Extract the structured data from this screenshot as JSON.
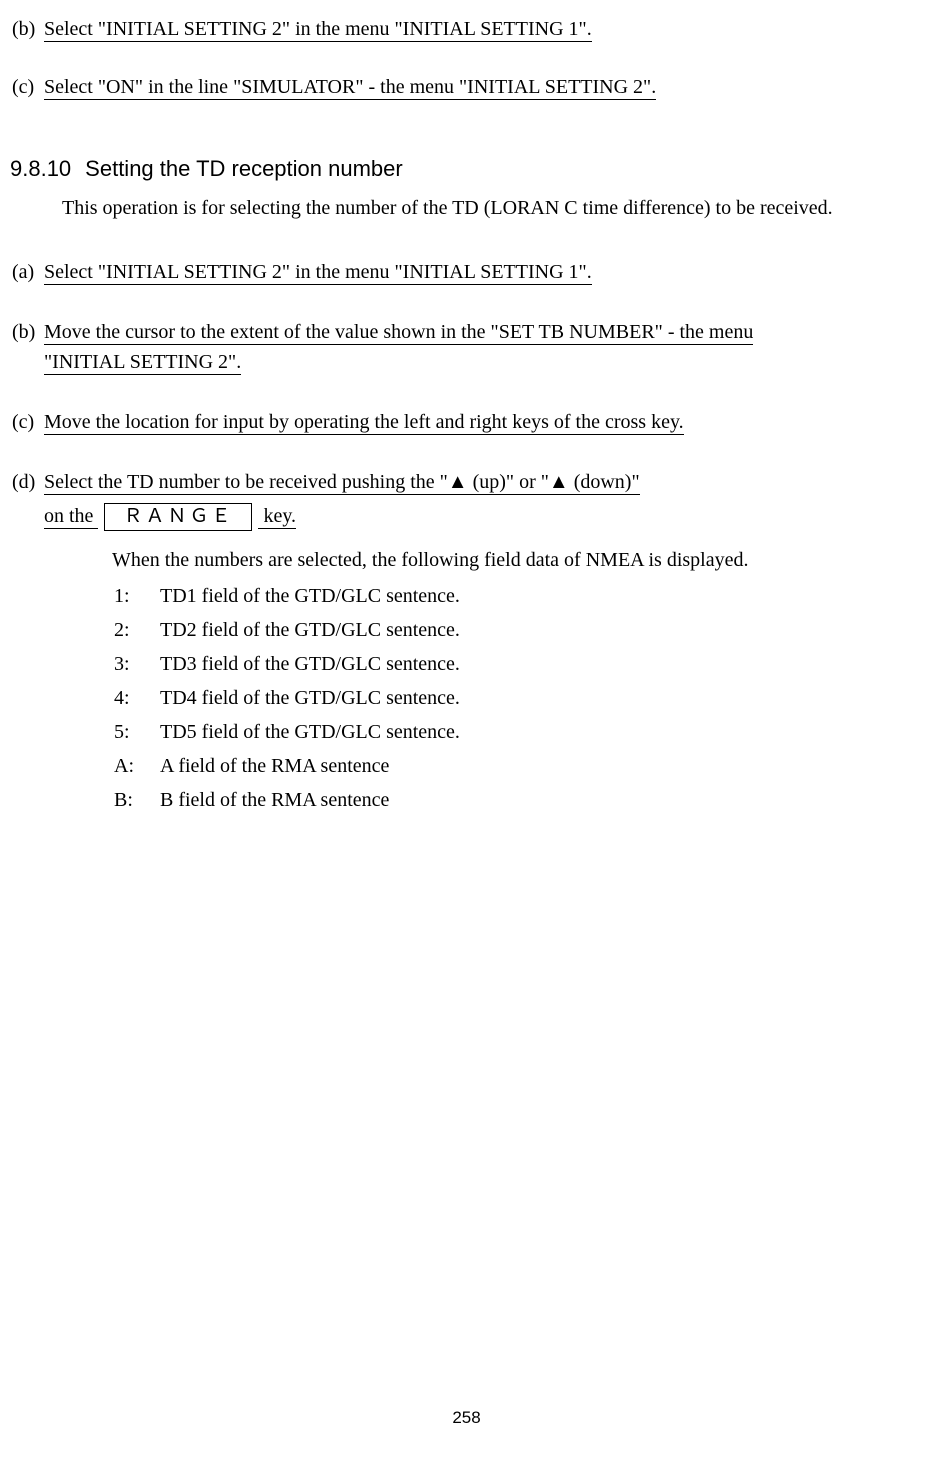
{
  "top_steps": {
    "b": {
      "marker": "(b)",
      "text": "Select \"INITIAL SETTING 2\" in the menu \"INITIAL SETTING 1\". "
    },
    "c": {
      "marker": "(c)",
      "text": "Select \"ON\" in the line \"SIMULATOR\" - the menu \"INITIAL SETTING 2\"."
    }
  },
  "heading": {
    "number": "9.8.10",
    "title": "Setting the TD reception number"
  },
  "intro": "This operation is for selecting the number of the TD (LORAN C time difference) to be received.",
  "main_steps": {
    "a": {
      "marker": "(a)",
      "text": "Select \"INITIAL SETTING 2\" in the menu \"INITIAL SETTING 1\"."
    },
    "b": {
      "marker": "(b)",
      "line1": "Move the cursor to the extent of the value shown in the \"SET TB NUMBER\" - the menu",
      "line2": "\"INITIAL SETTING 2\". "
    },
    "c": {
      "marker": "(c)",
      "text": "Move the location for input by operating the left and right keys of the cross key. "
    },
    "d": {
      "marker": "(d)",
      "line1": "Select the TD number to be received pushing the \"▲ (up)\" or \"▲ (down)\"",
      "line2_pre": "on the ",
      "key_label": "ＲＡＮＧＥ",
      "line2_post": " key. "
    }
  },
  "after": {
    "intro": "When the numbers are selected, the following field data of NMEA is displayed.",
    "rows": [
      {
        "k": "1:",
        "v": "TD1 field of the GTD/GLC sentence."
      },
      {
        "k": "2:",
        "v": "TD2 field of the GTD/GLC sentence."
      },
      {
        "k": "3:",
        "v": "TD3 field of the GTD/GLC sentence."
      },
      {
        "k": "4:",
        "v": "TD4 field of the GTD/GLC sentence."
      },
      {
        "k": "5:",
        "v": "TD5 field of the GTD/GLC sentence."
      },
      {
        "k": "A:",
        "v": "A field of the RMA sentence"
      },
      {
        "k": "B:",
        "v": "B field of the RMA sentence"
      }
    ]
  },
  "page_number": "258"
}
